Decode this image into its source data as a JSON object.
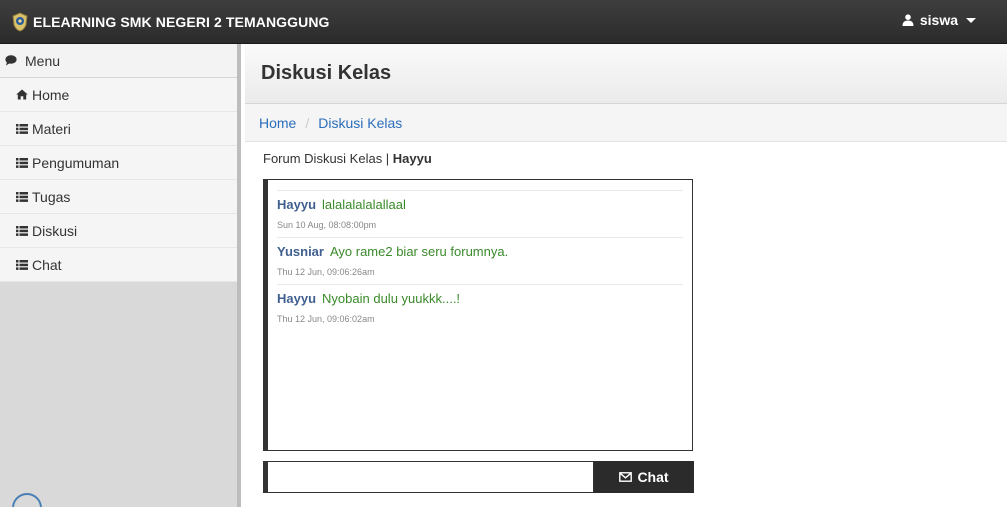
{
  "navbar": {
    "brand_title": "ELEARNING SMK NEGERI 2 TEMANGGUNG",
    "logo_icon": "school-emblem-icon",
    "user_label": "siswa",
    "user_icon": "user-icon",
    "colors": {
      "background": "#333333",
      "text": "#ffffff"
    }
  },
  "sidebar": {
    "header_label": "Menu",
    "header_icon": "comment-icon",
    "items": [
      {
        "label": "Home",
        "icon": "home-icon"
      },
      {
        "label": "Materi",
        "icon": "list-icon"
      },
      {
        "label": "Pengumuman",
        "icon": "list-icon"
      },
      {
        "label": "Tugas",
        "icon": "list-icon"
      },
      {
        "label": "Diskusi",
        "icon": "list-icon"
      },
      {
        "label": "Chat",
        "icon": "list-icon"
      }
    ]
  },
  "main": {
    "page_title": "Diskusi Kelas",
    "breadcrumb": [
      "Home",
      "Diskusi Kelas"
    ],
    "breadcrumb_separator": "/",
    "forum_prefix": "Forum Diskusi Kelas | ",
    "forum_user": "Hayyu"
  },
  "chat": {
    "messages": [
      {
        "user": "Hayyu",
        "text": "lalalalalalallaal",
        "time": "Sun 10 Aug, 08:08:00pm"
      },
      {
        "user": "Yusniar",
        "text": "Ayo rame2 biar seru forumnya.",
        "time": "Thu 12 Jun, 09:06:26am"
      },
      {
        "user": "Hayyu",
        "text": "Nyobain dulu yuukkk....!",
        "time": "Thu 12 Jun, 09:06:02am"
      }
    ],
    "input_value": "",
    "input_placeholder": "",
    "button_label": "Chat",
    "button_icon": "envelope-icon",
    "colors": {
      "user": "#3f5f8f",
      "text": "#3a8a2a",
      "button": "#2b2b2b"
    }
  }
}
